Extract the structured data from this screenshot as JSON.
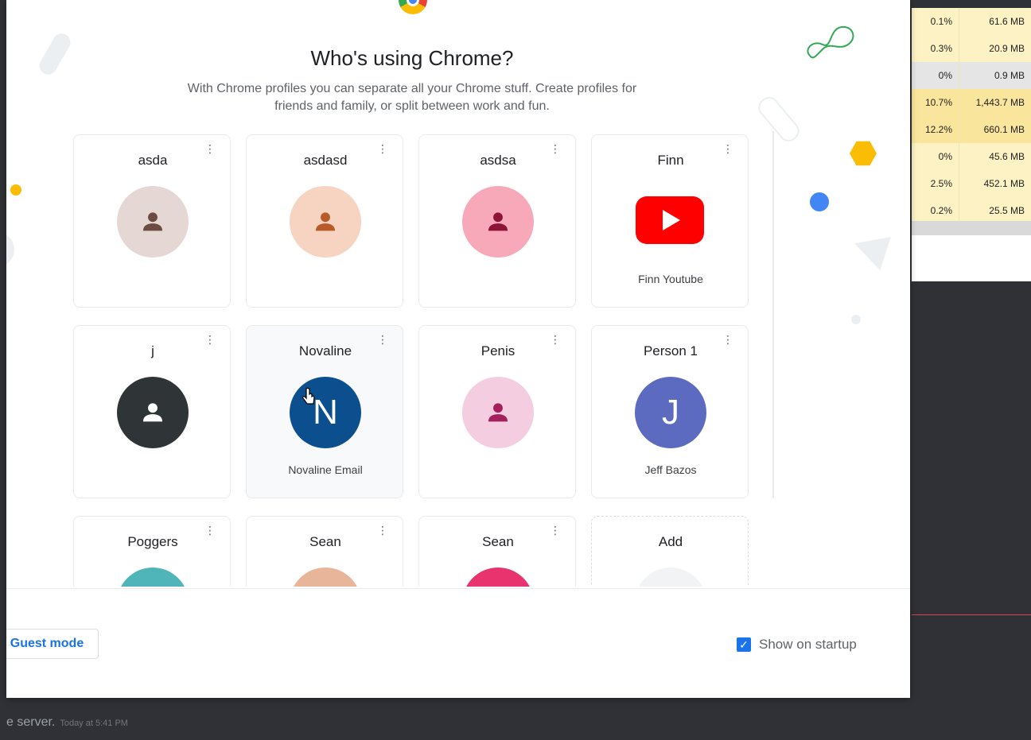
{
  "window": {
    "title": "Who's using Chrome?",
    "subtitle": "With Chrome profiles you can separate all your Chrome stuff. Create profiles for friends and family, or split between work and fun."
  },
  "profiles": [
    {
      "name": "asda",
      "subtitle": "",
      "avatar_type": "person-icon",
      "bg": "#e5d8d4",
      "fg": "#6b4b42"
    },
    {
      "name": "asdasd",
      "subtitle": "",
      "avatar_type": "person-icon",
      "bg": "#f7d3c1",
      "fg": "#b85a2a"
    },
    {
      "name": "asdsa",
      "subtitle": "",
      "avatar_type": "person-icon",
      "bg": "#f7a9ba",
      "fg": "#8d1437"
    },
    {
      "name": "Finn",
      "subtitle": "Finn Youtube",
      "avatar_type": "youtube-icon",
      "bg": "#ff0000",
      "fg": "#ffffff"
    },
    {
      "name": "j",
      "subtitle": "",
      "avatar_type": "person-icon",
      "bg": "#2f3437",
      "fg": "#ffffff"
    },
    {
      "name": "Novaline",
      "subtitle": "Novaline Email",
      "avatar_type": "letter",
      "letter": "N",
      "bg": "#0b4f8e",
      "fg": "#ffffff"
    },
    {
      "name": "Penis",
      "subtitle": "",
      "avatar_type": "person-icon",
      "bg": "#f5cde0",
      "fg": "#a3205d"
    },
    {
      "name": "Person 1",
      "subtitle": "Jeff Bazos",
      "avatar_type": "letter",
      "letter": "J",
      "bg": "#5c6bc0",
      "fg": "#ffffff"
    },
    {
      "name": "Poggers",
      "subtitle": "",
      "avatar_type": "partial",
      "bg": "#4fb5b9",
      "fg": "#ffffff"
    },
    {
      "name": "Sean",
      "subtitle": "",
      "avatar_type": "partial",
      "bg": "#e8b49a",
      "fg": "#ffffff"
    },
    {
      "name": "Sean",
      "subtitle": "",
      "avatar_type": "partial",
      "bg": "#e8336e",
      "fg": "#ffffff"
    }
  ],
  "add_card": {
    "label": "Add"
  },
  "footer": {
    "guest_label": "Guest mode",
    "show_on_startup_label": "Show on startup",
    "show_on_startup_checked": true
  },
  "task_manager": {
    "rows": [
      {
        "cpu": "0.1%",
        "mem": "61.6 MB"
      },
      {
        "cpu": "0.3%",
        "mem": "20.9 MB"
      },
      {
        "cpu": "0%",
        "mem": "0.9 MB"
      },
      {
        "cpu": "10.7%",
        "mem": "1,443.7 MB"
      },
      {
        "cpu": "12.2%",
        "mem": "660.1 MB"
      },
      {
        "cpu": "0%",
        "mem": "45.6 MB"
      },
      {
        "cpu": "2.5%",
        "mem": "452.1 MB"
      },
      {
        "cpu": "0.2%",
        "mem": "25.5 MB"
      }
    ]
  },
  "background_message": {
    "text": "e server.",
    "time": "Today at 5:41 PM"
  },
  "colors": {
    "accent": "#1a73e8",
    "taskmgr_highlight": "#fdf2c4",
    "taskmgr_highlight_strong": "#f9e59b"
  }
}
